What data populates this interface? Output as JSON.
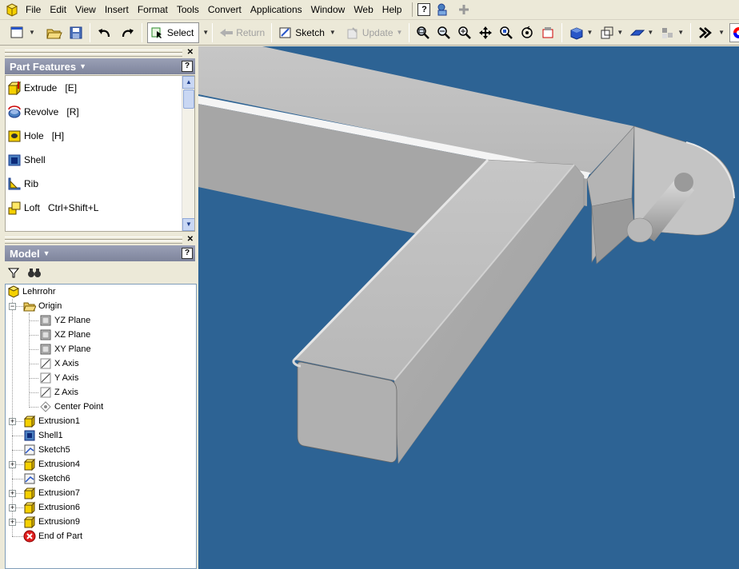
{
  "menu": {
    "items": [
      "File",
      "Edit",
      "View",
      "Insert",
      "Format",
      "Tools",
      "Convert",
      "Applications",
      "Window",
      "Web",
      "Help"
    ],
    "help_q": "?"
  },
  "toolbar": {
    "select_label": "Select",
    "return_label": "Return",
    "sketch_label": "Sketch",
    "update_label": "Update"
  },
  "part_features": {
    "title": "Part Features",
    "help": "?",
    "items": [
      {
        "label": "Extrude",
        "shortcut": "[E]"
      },
      {
        "label": "Revolve",
        "shortcut": "[R]"
      },
      {
        "label": "Hole",
        "shortcut": "[H]"
      },
      {
        "label": "Shell",
        "shortcut": ""
      },
      {
        "label": "Rib",
        "shortcut": ""
      },
      {
        "label": "Loft",
        "shortcut": "Ctrl+Shift+L"
      }
    ]
  },
  "model": {
    "title": "Model",
    "help": "?",
    "tree": [
      {
        "label": "Lehrrohr"
      },
      {
        "label": "Origin"
      },
      {
        "label": "YZ Plane"
      },
      {
        "label": "XZ Plane"
      },
      {
        "label": "XY Plane"
      },
      {
        "label": "X Axis"
      },
      {
        "label": "Y Axis"
      },
      {
        "label": "Z Axis"
      },
      {
        "label": "Center Point"
      },
      {
        "label": "Extrusion1"
      },
      {
        "label": "Shell1"
      },
      {
        "label": "Sketch5"
      },
      {
        "label": "Extrusion4"
      },
      {
        "label": "Sketch6"
      },
      {
        "label": "Extrusion7"
      },
      {
        "label": "Extrusion6"
      },
      {
        "label": "Extrusion9"
      },
      {
        "label": "End of Part"
      }
    ]
  },
  "colors": {
    "viewport_bg": "#2d6394",
    "part_face_light": "#c8c8c8",
    "part_face_mid": "#a8a8a8",
    "part_face_dark": "#8a8a8a",
    "header_bg": "#8a8fa8"
  }
}
